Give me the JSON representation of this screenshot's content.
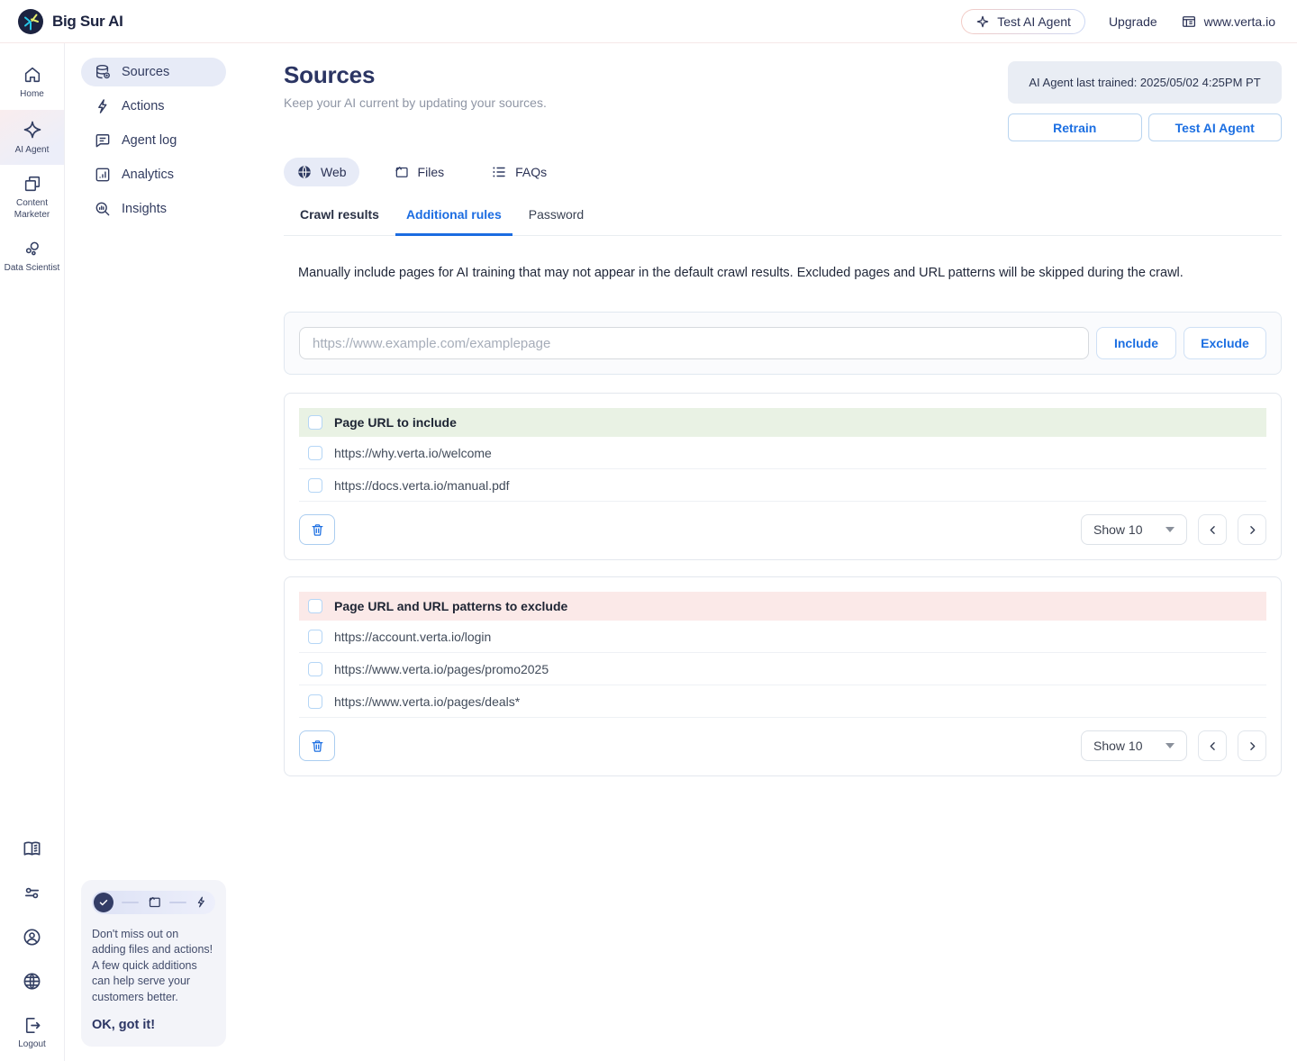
{
  "header": {
    "brand": "Big Sur AI",
    "test_ai_agent_label": "Test AI Agent",
    "upgrade_label": "Upgrade",
    "site": "www.verta.io"
  },
  "rail": {
    "items": [
      {
        "label": "Home"
      },
      {
        "label": "AI Agent"
      },
      {
        "label": "Content Marketer"
      },
      {
        "label": "Data Scientist"
      }
    ],
    "logout_label": "Logout"
  },
  "subnav": {
    "items": [
      {
        "label": "Sources"
      },
      {
        "label": "Actions"
      },
      {
        "label": "Agent log"
      },
      {
        "label": "Analytics"
      },
      {
        "label": "Insights"
      }
    ]
  },
  "page": {
    "title": "Sources",
    "subtitle": "Keep your AI current by updating your sources.",
    "last_trained": "AI Agent last trained: 2025/05/02 4:25PM PT",
    "retrain_label": "Retrain",
    "test_agent_label": "Test AI Agent"
  },
  "tabs": [
    {
      "label": "Web"
    },
    {
      "label": "Files"
    },
    {
      "label": "FAQs"
    }
  ],
  "subtabs": [
    {
      "label": "Crawl results"
    },
    {
      "label": "Additional rules"
    },
    {
      "label": "Password"
    }
  ],
  "description": "Manually include pages for AI training that may not appear in the default crawl results. Excluded pages and URL patterns will be skipped during the crawl.",
  "url_form": {
    "placeholder": "https://www.example.com/examplepage",
    "include_label": "Include",
    "exclude_label": "Exclude"
  },
  "include_table": {
    "header": "Page URL to include",
    "rows": [
      "https://why.verta.io/welcome",
      "https://docs.verta.io/manual.pdf"
    ]
  },
  "exclude_table": {
    "header": "Page URL and URL patterns to exclude",
    "rows": [
      "https://account.verta.io/login",
      "https://www.verta.io/pages/promo2025",
      "https://www.verta.io/pages/deals*"
    ]
  },
  "pagination": {
    "show_label": "Show 10"
  },
  "promo": {
    "message": "Don't miss out on adding files and actions! A few quick additions can help serve your customers better.",
    "cta": "OK, got it!"
  },
  "colors": {
    "accent_blue": "#1b6ce1",
    "brand_navy": "#1c2340",
    "include_green_bg": "#e9f2e4",
    "exclude_pink_bg": "#fbe9e8",
    "active_pill_bg": "#e7ebf7"
  }
}
